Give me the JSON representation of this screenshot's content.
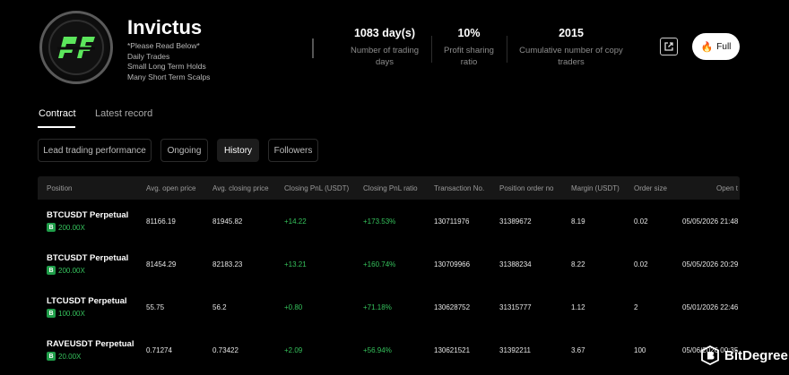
{
  "profile": {
    "name": "Invictus",
    "bio": [
      "*Please Read Below*",
      "Daily Trades",
      "Small Long Term Holds",
      "Many Short Term Scalps"
    ]
  },
  "stats": [
    {
      "value": "1083 day(s)",
      "label": [
        "Number of trading",
        "days"
      ]
    },
    {
      "value": "10%",
      "label": [
        "Profit sharing",
        "ratio"
      ]
    },
    {
      "value": "2015",
      "label": [
        "Cumulative number of copy",
        "traders"
      ]
    }
  ],
  "actions": {
    "full_label": "Full"
  },
  "tabs": {
    "contract": "Contract",
    "latest": "Latest record"
  },
  "subtabs": [
    "Lead trading performance",
    "Ongoing",
    "History",
    "Followers"
  ],
  "table": {
    "headers": [
      "Position",
      "Avg. open price",
      "Avg. closing price",
      "Closing PnL (USDT)",
      "Closing PnL ratio",
      "Transaction No.",
      "Position order no",
      "Margin (USDT)",
      "Order size",
      "Open t"
    ],
    "rows": [
      {
        "symbol": "BTCUSDT Perpetual",
        "leverage": "200.00X",
        "open": "81166.19",
        "close": "81945.82",
        "pnl": "+14.22",
        "ratio": "+173.53%",
        "txn": "130711976",
        "order": "31389672",
        "margin": "8.19",
        "size": "0.02",
        "time": "05/05/2026 21:48"
      },
      {
        "symbol": "BTCUSDT Perpetual",
        "leverage": "200.00X",
        "open": "81454.29",
        "close": "82183.23",
        "pnl": "+13.21",
        "ratio": "+160.74%",
        "txn": "130709966",
        "order": "31388234",
        "margin": "8.22",
        "size": "0.02",
        "time": "05/05/2026 20:29"
      },
      {
        "symbol": "LTCUSDT Perpetual",
        "leverage": "100.00X",
        "open": "55.75",
        "close": "56.2",
        "pnl": "+0.80",
        "ratio": "+71.18%",
        "txn": "130628752",
        "order": "31315777",
        "margin": "1.12",
        "size": "2",
        "time": "05/01/2026 22:46"
      },
      {
        "symbol": "RAVEUSDT Perpetual",
        "leverage": "20.00X",
        "open": "0.71274",
        "close": "0.73422",
        "pnl": "+2.09",
        "ratio": "+56.94%",
        "txn": "130621521",
        "order": "31392211",
        "margin": "3.67",
        "size": "100",
        "time": "05/06/2026 00:35"
      }
    ]
  },
  "watermark": {
    "text": "BitDegree"
  },
  "colors": {
    "positive": "#35c25c",
    "background": "#000000",
    "header_row": "#171717"
  }
}
